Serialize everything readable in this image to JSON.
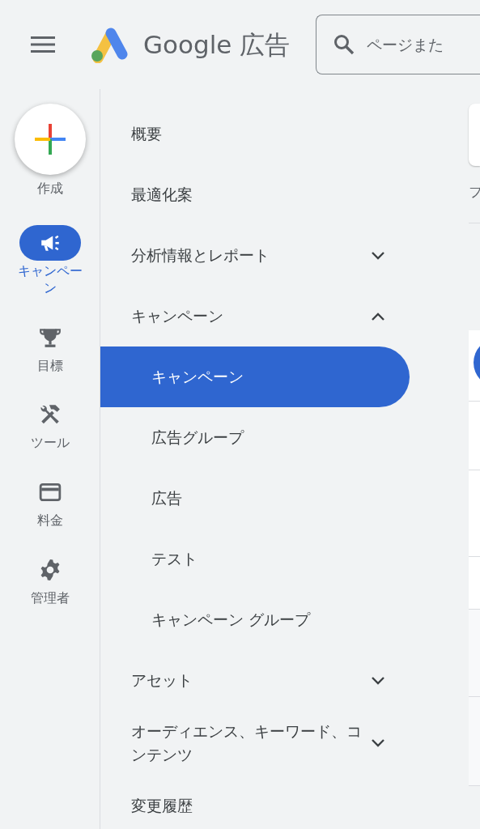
{
  "header": {
    "logo_text": "Google 広告",
    "search": {
      "placeholder": "ページまた"
    }
  },
  "rail": {
    "create": {
      "label": "作成"
    },
    "items": [
      {
        "label": "キャンペーン",
        "selected": true
      },
      {
        "label": "目標",
        "selected": false
      },
      {
        "label": "ツール",
        "selected": false
      },
      {
        "label": "料金",
        "selected": false
      },
      {
        "label": "管理者",
        "selected": false
      }
    ]
  },
  "nav": {
    "items": [
      {
        "label": "概要"
      },
      {
        "label": "最適化案"
      },
      {
        "label": "分析情報とレポート",
        "expanded": false
      },
      {
        "label": "キャンペーン",
        "expanded": true,
        "children": [
          {
            "label": "キャンペーン",
            "selected": true
          },
          {
            "label": "広告グループ",
            "selected": false
          },
          {
            "label": "広告",
            "selected": false
          },
          {
            "label": "テスト",
            "selected": false
          },
          {
            "label": "キャンペーン グループ",
            "selected": false
          }
        ]
      },
      {
        "label": "アセット",
        "expanded": false
      },
      {
        "label": "オーディエンス、キーワード、コンテンツ",
        "expanded": false
      },
      {
        "label": "変更履歴"
      }
    ]
  },
  "main": {
    "caption": "フ"
  }
}
